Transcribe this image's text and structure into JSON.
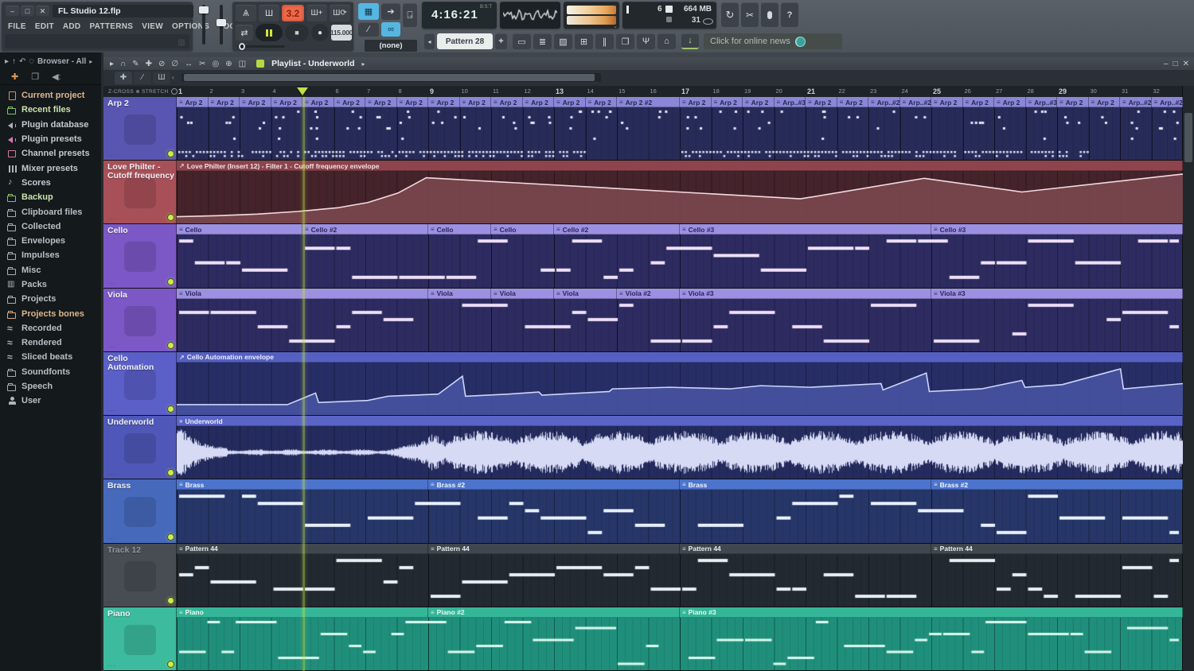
{
  "window": {
    "title": "FL Studio 12.flp",
    "menus": [
      "FILE",
      "EDIT",
      "ADD",
      "PATTERNS",
      "VIEW",
      "OPTIONS",
      "TOOLS",
      "?"
    ]
  },
  "icons": {
    "minimize": "–",
    "maximize": "□",
    "close": "✕",
    "metronome": "Ѧ",
    "wait": "Ш",
    "blend": "Ш+",
    "looprec": "Ш⟳",
    "repeat": "⇄",
    "stop": "■",
    "record": "●",
    "sync": "↻",
    "cut": "✂",
    "help": "?",
    "arrow": "➔",
    "link": "∞",
    "slide": "∕",
    "typing": "▦",
    "download": "↓",
    "prev": "◂",
    "plus": "+",
    "up": "⌃",
    "left": "‹",
    "audio_prefix": "»",
    "auto_prefix": "↗",
    "clip_prefix": "≡"
  },
  "transport": {
    "position_display": "3.2",
    "tempo": "115.000",
    "time": "4:16:21",
    "time_mode": "B:S:T",
    "pattern": "Pattern 28",
    "none_label": "(none)",
    "news": "Click for online news",
    "cpu": {
      "value": "6",
      "memory": "664 MB",
      "voices": "31"
    },
    "view_buttons": [
      {
        "name": "playlist-view",
        "glyph": "▭"
      },
      {
        "name": "channel-rack-view",
        "glyph": "≣"
      },
      {
        "name": "piano-roll-view",
        "glyph": "▨"
      },
      {
        "name": "browser-view",
        "glyph": "⊞"
      },
      {
        "name": "mixer-view",
        "glyph": "∥"
      },
      {
        "name": "plugin-picker-view",
        "glyph": "❐"
      },
      {
        "name": "plugin-view",
        "glyph": "Ψ"
      },
      {
        "name": "touch-view",
        "glyph": "⌂"
      }
    ]
  },
  "browser": {
    "breadcrumb": "Browser - All",
    "items": [
      {
        "label": "Current project",
        "icon": "doc",
        "ic": "#d98f6e",
        "tx": "#dcb795"
      },
      {
        "label": "Recent files",
        "icon": "folder",
        "ic": "#84c465",
        "tx": "#c8e2ac"
      },
      {
        "label": "Plugin database",
        "icon": "speaker",
        "ic": "#a8b0b8",
        "tx": "#c2c9cf"
      },
      {
        "label": "Plugin presets",
        "icon": "speaker",
        "ic": "#d678b8",
        "tx": "#c2c9cf"
      },
      {
        "label": "Channel presets",
        "icon": "box",
        "ic": "#d87898",
        "tx": "#c2c9cf"
      },
      {
        "label": "Mixer presets",
        "icon": "mixer",
        "ic": "#aeb5bb",
        "tx": "#c2c9cf"
      },
      {
        "label": "Scores",
        "icon": "note",
        "ic": "#aeb5bb",
        "tx": "#c2c9cf"
      },
      {
        "label": "Backup",
        "icon": "folder",
        "ic": "#84c465",
        "tx": "#c8e2ac"
      },
      {
        "label": "Clipboard files",
        "icon": "folder",
        "ic": "#a8afb5",
        "tx": "#b8bfc5"
      },
      {
        "label": "Collected",
        "icon": "folder",
        "ic": "#a8afb5",
        "tx": "#b8bfc5"
      },
      {
        "label": "Envelopes",
        "icon": "folder",
        "ic": "#a8afb5",
        "tx": "#b8bfc5"
      },
      {
        "label": "Impulses",
        "icon": "folder",
        "ic": "#a8afb5",
        "tx": "#b8bfc5"
      },
      {
        "label": "Misc",
        "icon": "folder",
        "ic": "#a8afb5",
        "tx": "#b8bfc5"
      },
      {
        "label": "Packs",
        "icon": "packs",
        "ic": "#aeb5bb",
        "tx": "#b8bfc5"
      },
      {
        "label": "Projects",
        "icon": "folder",
        "ic": "#a8afb5",
        "tx": "#b8bfc5"
      },
      {
        "label": "Projects bones",
        "icon": "folder",
        "ic": "#d9a878",
        "tx": "#dcb48a"
      },
      {
        "label": "Recorded",
        "icon": "wave",
        "ic": "#aeb5bb",
        "tx": "#b8bfc5"
      },
      {
        "label": "Rendered",
        "icon": "wave",
        "ic": "#aeb5bb",
        "tx": "#b8bfc5"
      },
      {
        "label": "Sliced beats",
        "icon": "wave",
        "ic": "#aeb5bb",
        "tx": "#b8bfc5"
      },
      {
        "label": "Soundfonts",
        "icon": "folder",
        "ic": "#a8afb5",
        "tx": "#b8bfc5"
      },
      {
        "label": "Speech",
        "icon": "folder",
        "ic": "#a8afb5",
        "tx": "#b8bfc5"
      },
      {
        "label": "User",
        "icon": "user",
        "ic": "#aeb5bb",
        "tx": "#b8bfc5"
      }
    ]
  },
  "playlist": {
    "title": "Playlist - Underworld",
    "bars": 32,
    "playhead_bar": 5,
    "corner": {
      "zcross": "Z-CROSS",
      "stretch": "STRETCH"
    },
    "tools": [
      {
        "name": "menu-arrow",
        "glyph": "▸"
      },
      {
        "name": "snap-magnet",
        "glyph": "∩"
      },
      {
        "name": "draw-tool",
        "glyph": "✎"
      },
      {
        "name": "paint-tool",
        "glyph": "✚"
      },
      {
        "name": "delete-tool",
        "glyph": "⊘"
      },
      {
        "name": "mute-tool",
        "glyph": "∅"
      },
      {
        "name": "slip-tool",
        "glyph": "↔"
      },
      {
        "name": "slice-tool",
        "glyph": "✂"
      },
      {
        "name": "select-tool",
        "glyph": "◎"
      },
      {
        "name": "zoom-tool",
        "glyph": "⊕"
      },
      {
        "name": "preview-tool",
        "glyph": "◫"
      }
    ],
    "tracks": [
      {
        "name": "Arp 2",
        "kind": "dots",
        "header": "#5956b2",
        "strip": "#8a87d8",
        "strip_text": "#23284e",
        "body": "#272b58",
        "note": "#e9ebff",
        "clips": [
          {
            "s": 1,
            "l": 1,
            "n": "Arp 2"
          },
          {
            "s": 2,
            "l": 1,
            "n": "Arp 2"
          },
          {
            "s": 3,
            "l": 1,
            "n": "Arp 2"
          },
          {
            "s": 4,
            "l": 1,
            "n": "Arp 2"
          },
          {
            "s": 5,
            "l": 1,
            "n": "Arp 2"
          },
          {
            "s": 6,
            "l": 1,
            "n": "Arp 2"
          },
          {
            "s": 7,
            "l": 1,
            "n": "Arp 2"
          },
          {
            "s": 8,
            "l": 1,
            "n": "Arp 2"
          },
          {
            "s": 9,
            "l": 1,
            "n": "Arp 2"
          },
          {
            "s": 10,
            "l": 1,
            "n": "Arp 2"
          },
          {
            "s": 11,
            "l": 1,
            "n": "Arp 2"
          },
          {
            "s": 12,
            "l": 1,
            "n": "Arp 2"
          },
          {
            "s": 13,
            "l": 1,
            "n": "Arp 2"
          },
          {
            "s": 14,
            "l": 1,
            "n": "Arp 2"
          },
          {
            "s": 15,
            "l": 2,
            "n": "Arp 2 #2"
          },
          {
            "s": 17,
            "l": 1,
            "n": "Arp 2"
          },
          {
            "s": 18,
            "l": 1,
            "n": "Arp 2"
          },
          {
            "s": 19,
            "l": 1,
            "n": "Arp 2"
          },
          {
            "s": 20,
            "l": 1,
            "n": "Arp..#3"
          },
          {
            "s": 21,
            "l": 1,
            "n": "Arp 2"
          },
          {
            "s": 22,
            "l": 1,
            "n": "Arp 2"
          },
          {
            "s": 23,
            "l": 1,
            "n": "Arp..#2"
          },
          {
            "s": 24,
            "l": 1,
            "n": "Arp..#2"
          },
          {
            "s": 25,
            "l": 1,
            "n": "Arp 2"
          },
          {
            "s": 26,
            "l": 1,
            "n": "Arp 2"
          },
          {
            "s": 27,
            "l": 1,
            "n": "Arp 2"
          },
          {
            "s": 28,
            "l": 1,
            "n": "Arp..#3"
          },
          {
            "s": 29,
            "l": 1,
            "n": "Arp 2"
          },
          {
            "s": 30,
            "l": 1,
            "n": "Arp 2"
          },
          {
            "s": 31,
            "l": 1,
            "n": "Arp..#2"
          },
          {
            "s": 32,
            "l": 1,
            "n": "Arp..#2"
          }
        ]
      },
      {
        "name": "Love Philter - Cutoff frequency",
        "kind": "automation",
        "header": "#a85058",
        "strip": "#8d444d",
        "strip_text": "#f2e2e4",
        "body": "#44232b",
        "fill": "#7c4a50",
        "line": "#f4dadd",
        "curve": [
          [
            0,
            87
          ],
          [
            4,
            85
          ],
          [
            8,
            82
          ],
          [
            12,
            77
          ],
          [
            16,
            70
          ],
          [
            19,
            60
          ],
          [
            22,
            42
          ],
          [
            24.8,
            13
          ],
          [
            62,
            53
          ],
          [
            74.3,
            14
          ],
          [
            84,
            40
          ],
          [
            100,
            6
          ]
        ],
        "clips": [
          {
            "s": 1,
            "l": 32,
            "n": "Love Philter (Insert 12) - Filter 1 - Cutoff frequency envelope",
            "p": "auto"
          }
        ]
      },
      {
        "name": "Cello",
        "kind": "notes",
        "header": "#7b58c6",
        "strip": "#9c90e2",
        "strip_text": "#2a2456",
        "body": "#2d2b60",
        "note": "#eedff8",
        "clips": [
          {
            "s": 1,
            "l": 4,
            "n": "Cello"
          },
          {
            "s": 5,
            "l": 4,
            "n": "Cello #2"
          },
          {
            "s": 9,
            "l": 2,
            "n": "Cello"
          },
          {
            "s": 11,
            "l": 2,
            "n": "Cello"
          },
          {
            "s": 13,
            "l": 4,
            "n": "Cello #2"
          },
          {
            "s": 17,
            "l": 8,
            "n": "Cello #3"
          },
          {
            "s": 25,
            "l": 8,
            "n": "Cello #3"
          }
        ]
      },
      {
        "name": "Viola",
        "kind": "notes",
        "header": "#7b58c6",
        "strip": "#9c90e2",
        "strip_text": "#2a2456",
        "body": "#2d2b60",
        "note": "#eedff8",
        "clips": [
          {
            "s": 1,
            "l": 8,
            "n": "Viola"
          },
          {
            "s": 9,
            "l": 2,
            "n": "Viola"
          },
          {
            "s": 11,
            "l": 2,
            "n": "Viola"
          },
          {
            "s": 13,
            "l": 2,
            "n": "Viola"
          },
          {
            "s": 15,
            "l": 2,
            "n": "Viola #2"
          },
          {
            "s": 17,
            "l": 8,
            "n": "Viola #3"
          },
          {
            "s": 25,
            "l": 8,
            "n": "Viola #3"
          }
        ]
      },
      {
        "name": "Cello Automation",
        "kind": "automation",
        "header": "#5b5fc8",
        "strip": "#5560c2",
        "strip_text": "#eceffc",
        "body": "#272e66",
        "fill": "#4a55a4",
        "line": "#ccd6fa",
        "curve": [
          [
            0,
            80
          ],
          [
            11,
            80
          ],
          [
            13.8,
            58
          ],
          [
            14.1,
            76
          ],
          [
            19,
            72
          ],
          [
            21,
            64
          ],
          [
            26,
            60
          ],
          [
            28.4,
            26
          ],
          [
            28.7,
            64
          ],
          [
            33,
            60
          ],
          [
            36,
            56
          ],
          [
            36.3,
            62
          ],
          [
            43,
            55
          ],
          [
            43.3,
            50
          ],
          [
            49,
            47
          ],
          [
            55,
            50
          ],
          [
            58,
            44
          ],
          [
            63,
            47
          ],
          [
            70,
            40
          ],
          [
            70.2,
            52
          ],
          [
            74.5,
            20
          ],
          [
            74.8,
            55
          ],
          [
            80,
            50
          ],
          [
            84,
            34
          ],
          [
            84.3,
            47
          ],
          [
            88,
            42
          ],
          [
            93.8,
            12
          ],
          [
            94.1,
            50
          ],
          [
            100,
            40
          ]
        ],
        "clips": [
          {
            "s": 1,
            "l": 32,
            "n": "Cello Automation envelope",
            "p": "auto"
          }
        ]
      },
      {
        "name": "Underworld",
        "kind": "audio",
        "header": "#4f58b8",
        "strip": "#5a64c6",
        "strip_text": "#eceffc",
        "body": "#242b5e",
        "note": "#d6daf4",
        "clips": [
          {
            "s": 1,
            "l": 32,
            "n": "Underworld",
            "p": "audio"
          }
        ]
      },
      {
        "name": "Brass",
        "kind": "notes",
        "header": "#4769bc",
        "strip": "#4d74cc",
        "strip_text": "#f0f5fd",
        "body": "#263668",
        "note": "#e6effc",
        "clips": [
          {
            "s": 1,
            "l": 8,
            "n": "Brass"
          },
          {
            "s": 9,
            "l": 8,
            "n": "Brass #2"
          },
          {
            "s": 17,
            "l": 8,
            "n": "Brass"
          },
          {
            "s": 25,
            "l": 8,
            "n": "Brass #2"
          }
        ]
      },
      {
        "name": "Track 12",
        "kind": "notes",
        "header": "#474d53",
        "name_color": "#8f979d",
        "strip": "#40474d",
        "strip_text": "#e8ecef",
        "body": "#222930",
        "note": "#e8f0f4",
        "clips": [
          {
            "s": 1,
            "l": 8,
            "n": "Pattern 44"
          },
          {
            "s": 9,
            "l": 8,
            "n": "Pattern 44"
          },
          {
            "s": 17,
            "l": 8,
            "n": "Pattern 44"
          },
          {
            "s": 25,
            "l": 8,
            "n": "Pattern 44"
          }
        ]
      },
      {
        "name": "Piano",
        "kind": "piano",
        "header": "#3cbb9e",
        "strip": "#35b698",
        "strip_text": "#eafaf4",
        "body": "#1f8f7b",
        "note": "#ddfbf0",
        "clips": [
          {
            "s": 1,
            "l": 8,
            "n": "Piano"
          },
          {
            "s": 9,
            "l": 8,
            "n": "Piano #2"
          },
          {
            "s": 17,
            "l": 16,
            "n": "Piano #3"
          }
        ]
      }
    ]
  }
}
